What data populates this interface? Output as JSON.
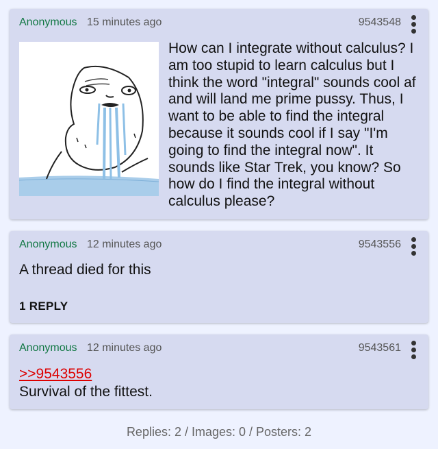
{
  "posts": [
    {
      "name": "Anonymous",
      "time": "15 minutes ago",
      "id": "9543548",
      "image_alt": "wojak crying meme",
      "text": "How can I integrate without calculus? I am too stupid to learn calculus but I think the word \"integral\" sounds cool af and will land me prime pussy. Thus, I want to be able to find the integral because it sounds cool if I say \"I'm going to find the integral now\". It sounds like Star Trek, you know? So how do I find the integral without calculus please?"
    },
    {
      "name": "Anonymous",
      "time": "12 minutes ago",
      "id": "9543556",
      "text": "A thread died for this",
      "replies": "1 REPLY"
    },
    {
      "name": "Anonymous",
      "time": "12 minutes ago",
      "id": "9543561",
      "quote": ">>9543556",
      "text": "Survival of the fittest."
    }
  ],
  "stats": "Replies: 2 / Images: 0 / Posters: 2",
  "colors": {
    "name": "#117743",
    "quote": "#dd0000",
    "post_bg": "#d6daf0",
    "page_bg": "#eef2ff"
  },
  "icons": {
    "menu": "vertical-ellipsis-icon"
  }
}
